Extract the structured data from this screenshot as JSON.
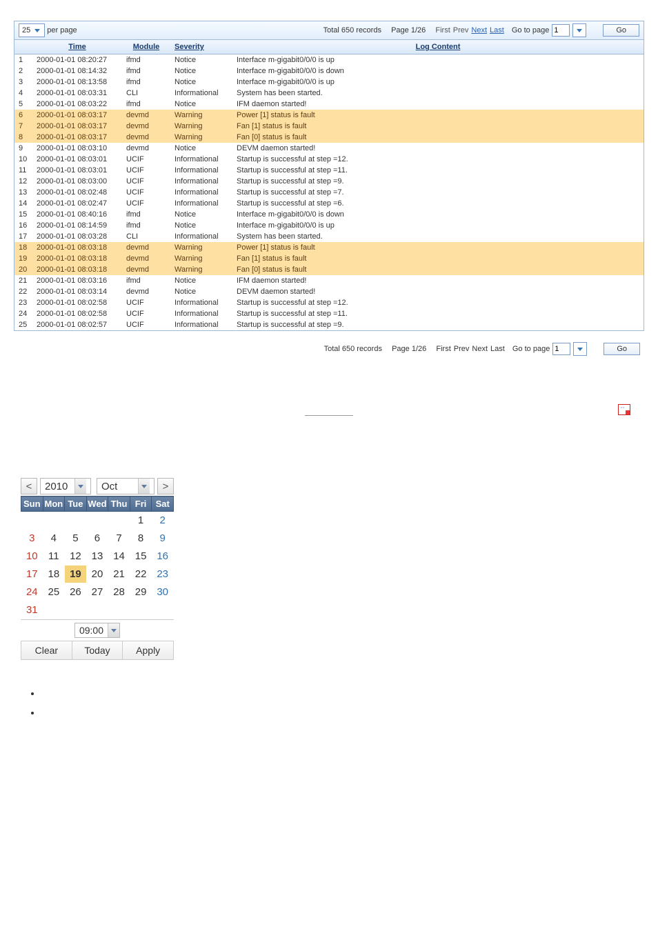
{
  "pager": {
    "per_page_value": "25",
    "per_page_label": "per page",
    "records_text": "Total 650 records",
    "page_text": "Page 1/26",
    "first": "First",
    "prev": "Prev",
    "next": "Next",
    "last": "Last",
    "goto_label": "Go to page",
    "goto_value": "1",
    "go_label": "Go"
  },
  "table": {
    "headers": {
      "time": "Time",
      "module": "Module",
      "severity": "Severity",
      "content": "Log Content"
    },
    "rows": [
      {
        "n": "1",
        "time": "2000-01-01 08:20:27",
        "mod": "ifmd",
        "sev": "Notice",
        "msg": "Interface m-gigabit0/0/0 is up",
        "warn": false
      },
      {
        "n": "2",
        "time": "2000-01-01 08:14:32",
        "mod": "ifmd",
        "sev": "Notice",
        "msg": "Interface m-gigabit0/0/0 is down",
        "warn": false
      },
      {
        "n": "3",
        "time": "2000-01-01 08:13:58",
        "mod": "ifmd",
        "sev": "Notice",
        "msg": "Interface m-gigabit0/0/0 is up",
        "warn": false
      },
      {
        "n": "4",
        "time": "2000-01-01 08:03:31",
        "mod": "CLI",
        "sev": "Informational",
        "msg": "System has been started.",
        "warn": false
      },
      {
        "n": "5",
        "time": "2000-01-01 08:03:22",
        "mod": "ifmd",
        "sev": "Notice",
        "msg": "IFM daemon started!",
        "warn": false
      },
      {
        "n": "6",
        "time": "2000-01-01 08:03:17",
        "mod": "devmd",
        "sev": "Warning",
        "msg": "Power [1] status is fault",
        "warn": true
      },
      {
        "n": "7",
        "time": "2000-01-01 08:03:17",
        "mod": "devmd",
        "sev": "Warning",
        "msg": "Fan [1] status is fault",
        "warn": true
      },
      {
        "n": "8",
        "time": "2000-01-01 08:03:17",
        "mod": "devmd",
        "sev": "Warning",
        "msg": "Fan [0] status is fault",
        "warn": true
      },
      {
        "n": "9",
        "time": "2000-01-01 08:03:10",
        "mod": "devmd",
        "sev": "Notice",
        "msg": "DEVM daemon started!",
        "warn": false
      },
      {
        "n": "10",
        "time": "2000-01-01 08:03:01",
        "mod": "UCIF",
        "sev": "Informational",
        "msg": "Startup is successful at step =12.",
        "warn": false
      },
      {
        "n": "11",
        "time": "2000-01-01 08:03:01",
        "mod": "UCIF",
        "sev": "Informational",
        "msg": "Startup is successful at step =11.",
        "warn": false
      },
      {
        "n": "12",
        "time": "2000-01-01 08:03:00",
        "mod": "UCIF",
        "sev": "Informational",
        "msg": "Startup is successful at step =9.",
        "warn": false
      },
      {
        "n": "13",
        "time": "2000-01-01 08:02:48",
        "mod": "UCIF",
        "sev": "Informational",
        "msg": "Startup is successful at step =7.",
        "warn": false
      },
      {
        "n": "14",
        "time": "2000-01-01 08:02:47",
        "mod": "UCIF",
        "sev": "Informational",
        "msg": "Startup is successful at step =6.",
        "warn": false
      },
      {
        "n": "15",
        "time": "2000-01-01 08:40:16",
        "mod": "ifmd",
        "sev": "Notice",
        "msg": "Interface m-gigabit0/0/0 is down",
        "warn": false
      },
      {
        "n": "16",
        "time": "2000-01-01 08:14:59",
        "mod": "ifmd",
        "sev": "Notice",
        "msg": "Interface m-gigabit0/0/0 is up",
        "warn": false
      },
      {
        "n": "17",
        "time": "2000-01-01 08:03:28",
        "mod": "CLI",
        "sev": "Informational",
        "msg": "System has been started.",
        "warn": false
      },
      {
        "n": "18",
        "time": "2000-01-01 08:03:18",
        "mod": "devmd",
        "sev": "Warning",
        "msg": "Power [1] status is fault",
        "warn": true
      },
      {
        "n": "19",
        "time": "2000-01-01 08:03:18",
        "mod": "devmd",
        "sev": "Warning",
        "msg": "Fan [1] status is fault",
        "warn": true
      },
      {
        "n": "20",
        "time": "2000-01-01 08:03:18",
        "mod": "devmd",
        "sev": "Warning",
        "msg": "Fan [0] status is fault",
        "warn": true
      },
      {
        "n": "21",
        "time": "2000-01-01 08:03:16",
        "mod": "ifmd",
        "sev": "Notice",
        "msg": "IFM daemon started!",
        "warn": false
      },
      {
        "n": "22",
        "time": "2000-01-01 08:03:14",
        "mod": "devmd",
        "sev": "Notice",
        "msg": "DEVM daemon started!",
        "warn": false
      },
      {
        "n": "23",
        "time": "2000-01-01 08:02:58",
        "mod": "UCIF",
        "sev": "Informational",
        "msg": "Startup is successful at step =12.",
        "warn": false
      },
      {
        "n": "24",
        "time": "2000-01-01 08:02:58",
        "mod": "UCIF",
        "sev": "Informational",
        "msg": "Startup is successful at step =11.",
        "warn": false
      },
      {
        "n": "25",
        "time": "2000-01-01 08:02:57",
        "mod": "UCIF",
        "sev": "Informational",
        "msg": "Startup is successful at step =9.",
        "warn": false
      }
    ]
  },
  "calendar": {
    "prev": "<",
    "next": ">",
    "year": "2010",
    "month": "Oct",
    "dow": [
      "Sun",
      "Mon",
      "Tue",
      "Wed",
      "Thu",
      "Fri",
      "Sat"
    ],
    "weeks": [
      [
        "",
        "",
        "",
        "",
        "",
        "1",
        "2"
      ],
      [
        "3",
        "4",
        "5",
        "6",
        "7",
        "8",
        "9"
      ],
      [
        "10",
        "11",
        "12",
        "13",
        "14",
        "15",
        "16"
      ],
      [
        "17",
        "18",
        "19",
        "20",
        "21",
        "22",
        "23"
      ],
      [
        "24",
        "25",
        "26",
        "27",
        "28",
        "29",
        "30"
      ],
      [
        "31",
        "",
        "",
        "",
        "",
        "",
        ""
      ]
    ],
    "today": "19",
    "time": "09:00",
    "buttons": {
      "clear": "Clear",
      "today": "Today",
      "apply": "Apply"
    }
  }
}
